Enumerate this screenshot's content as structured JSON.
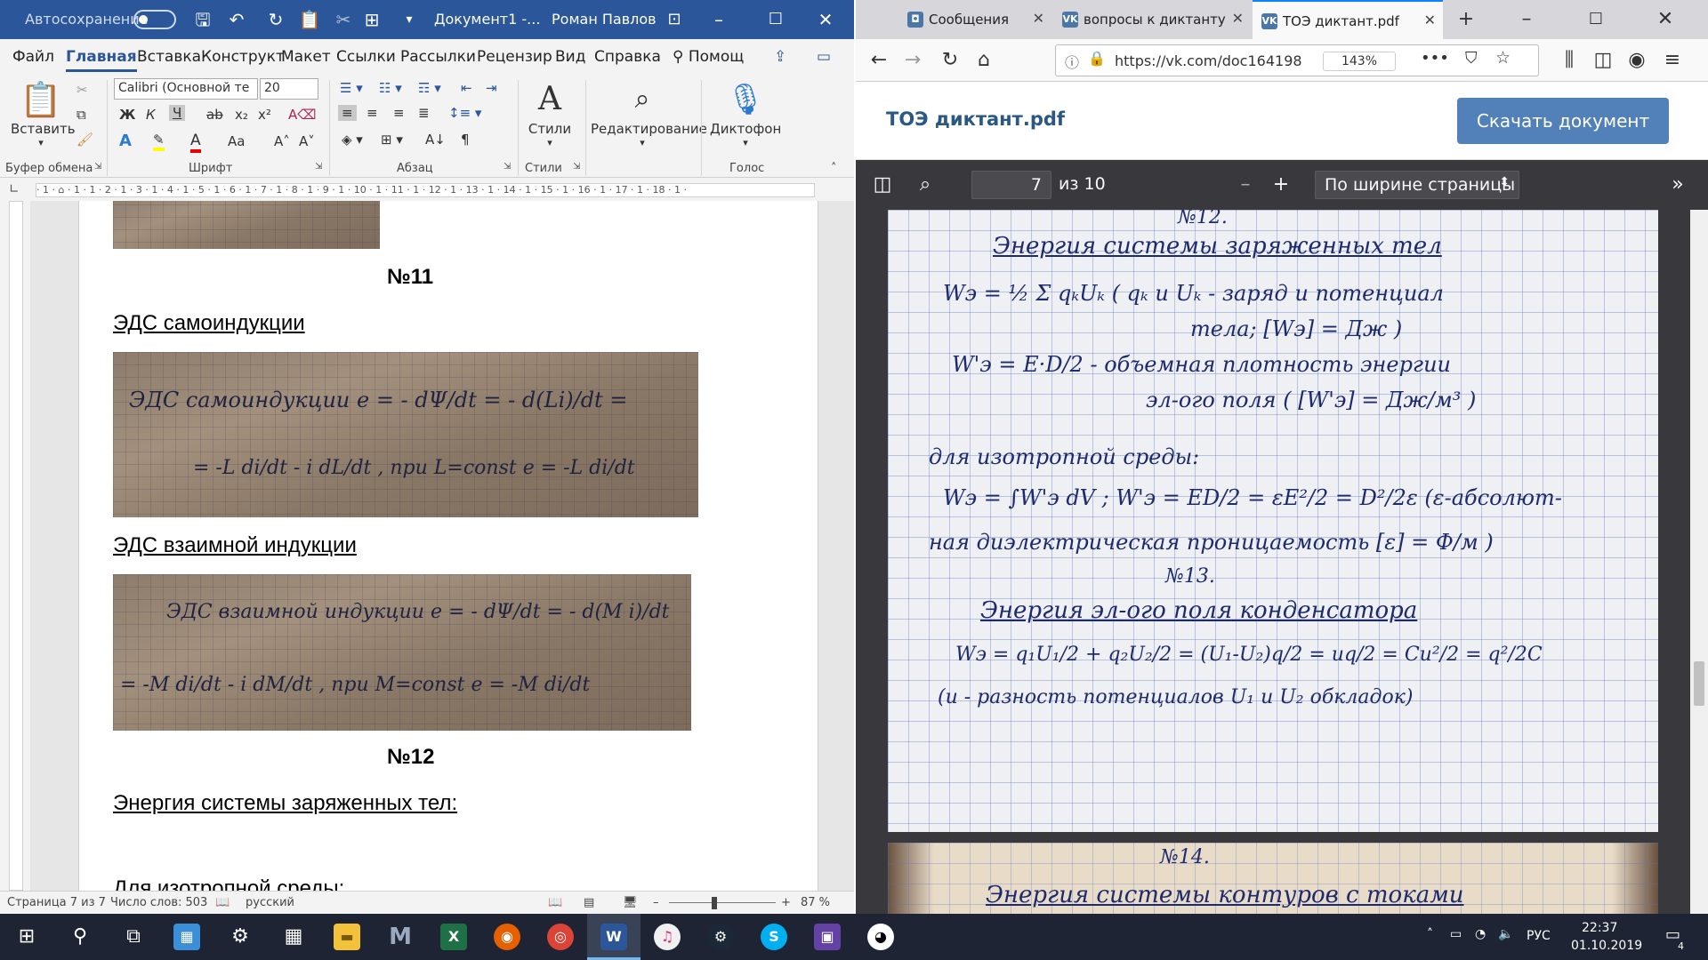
{
  "word": {
    "titlebar": {
      "autosave": "Автосохранение",
      "doc_title": "Документ1  -...",
      "user": "Роман Павлов"
    },
    "tabs": [
      "Файл",
      "Главная",
      "Вставка",
      "Конструкт",
      "Макет",
      "Ссылки",
      "Рассылки",
      "Рецензир",
      "Вид",
      "Справка"
    ],
    "tell_me": "Помощ",
    "ribbon": {
      "paste": "Вставить",
      "clipboard_group": "Буфер обмена",
      "font_name": "Calibri (Основной те",
      "font_size": "20",
      "font_group": "Шрифт",
      "paragraph_group": "Абзац",
      "styles_label": "Стили",
      "styles_group": "Стили",
      "editing_label": "Редактирование",
      "dictate_label": "Диктофон",
      "voice_group": "Голос",
      "bold": "Ж",
      "italic": "К",
      "underline": "Ч",
      "strike": "ab",
      "sub": "x₂",
      "sup": "x²",
      "case": "Aa",
      "grow": "A˄",
      "shrink": "A˅"
    },
    "ruler_text": "· 1 · ⌂ · 1 · 1 · 2 · 1 · 3 · 1 · 4 · 1 · 5 · 1 · 6 · 1 · 7 · 1 · 8 · 1 · 9 · 1 · 10 · 1 · 11 · 1 · 12 · 1 · 13 · 1 · 14 · 1 · 15 · 1 · 16 · 1 · 17 · 1 · 18 · 1 ·",
    "document": {
      "heading11": "№11",
      "eds_self": "ЭДС самоиндукции",
      "eds_mutual": "ЭДС взаимной индукции",
      "heading12": "№12",
      "energy": "Энергия системы заряженных тел:",
      "bottom_partial": "Для изотропной среды:",
      "photo1_line1": "ЭДС самоиндукции   e  = - dΨ/dt = - d(Li)/dt =",
      "photo1_line2": "= -L di/dt - i dL/dt  , при L=const   e = -L di/dt",
      "photo2_line1": "ЭДС взаимной индукции   e  = - dΨ/dt = - d(M i)/dt",
      "photo2_line2": "= -M di/dt - i dM/dt  , при M=const   e = -M di/dt"
    },
    "status": {
      "page": "Страница 7 из 7",
      "words": "Число слов: 503",
      "lang": "русский",
      "zoom": "87 %"
    }
  },
  "browser": {
    "tabs": [
      {
        "label": "Сообщения",
        "icon": "VK"
      },
      {
        "label": "вопросы к диктанту",
        "icon": "VK"
      },
      {
        "label": "ТОЭ диктант.pdf",
        "icon": "VK"
      }
    ],
    "url": "https://vk.com/doc164198",
    "zoom": "143%",
    "doc_title": "ТОЭ диктант.pdf",
    "download": "Скачать документ",
    "pdf": {
      "page": "7",
      "of": "из 10",
      "scale": "По ширине страницы"
    },
    "handwriting": {
      "h12": "№12.",
      "t12": "Энергия системы заряженных тел",
      "l1": "Wэ = ½ Σ qₖUₖ  ( qₖ и Uₖ - заряд и потенциал",
      "l2": "тела; [Wэ] = Дж )",
      "l3": "W'э = E·D/2  - объемная плотность энергии",
      "l4": "эл-ого поля ( [W'э] = Дж/м³ )",
      "l5": "для изотропной среды:",
      "l6": "Wэ = ∫W'э dV  ;  W'э = ED/2 = εE²/2 = D²/2ε  (ε-абсолют-",
      "l7": "ная диэлектрическая проницаемость [ε] = Ф/м )",
      "h13": "№13.",
      "t13": "Энергия эл-ого поля конденсатора",
      "l8": "Wэ = q₁U₁/2 + q₂U₂/2 = (U₁-U₂)q/2 = uq/2 = Cu²/2 = q²/2C",
      "l9": "(u - разность потенциалов U₁ и U₂ обкладок)",
      "h14": "№14.",
      "t14": "Энергия системы контуров с токами"
    }
  },
  "taskbar": {
    "lang": "РУС",
    "time": "22:37",
    "date": "01.10.2019",
    "notifications": "4"
  }
}
